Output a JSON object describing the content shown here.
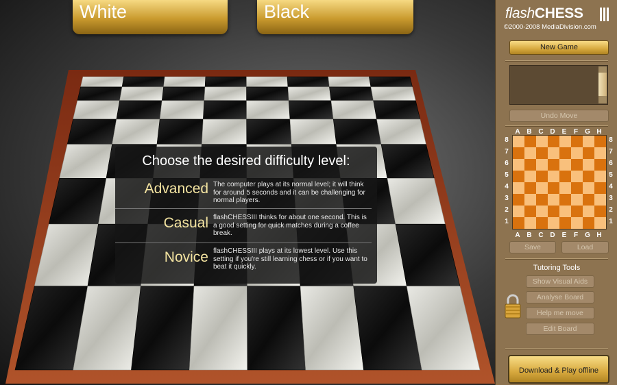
{
  "players": {
    "white_label": "White",
    "black_label": "Black"
  },
  "dialog": {
    "title": "Choose the desired difficulty level:",
    "options": [
      {
        "name": "Advanced",
        "description": "The computer plays at its normal level; it will think for around 5 seconds and it can be challenging for normal players."
      },
      {
        "name": "Casual",
        "description": "flashCHESSIII thinks for about one second. This is a good setting for quick matches during a coffee break."
      },
      {
        "name": "Novice",
        "description": "flashCHESSIII plays at its lowest level. Use this setting if you're still learning chess or if you want to beat it  quickly."
      }
    ]
  },
  "panel": {
    "logo_flash": "flash",
    "logo_chess": "CHESS",
    "copyright": "©2000-2008 MediaDivision.com",
    "new_game": "New Game",
    "undo_move": "Undo Move",
    "files": [
      "A",
      "B",
      "C",
      "D",
      "E",
      "F",
      "G",
      "H"
    ],
    "ranks": [
      "8",
      "7",
      "6",
      "5",
      "4",
      "3",
      "2",
      "1"
    ],
    "save": "Save",
    "load": "Load",
    "tutoring_title": "Tutoring Tools",
    "tools": [
      "Show Visual Aids",
      "Analyse Board",
      "Help me move",
      "Edit Board"
    ],
    "download": "Download & Play offline"
  },
  "colors": {
    "gold": "#d7a93e",
    "mini_light": "#f9c07c",
    "mini_dark": "#d9720e",
    "panel": "#8d7350",
    "option_text": "#f3e3a0"
  },
  "icons": {
    "lock": "padlock-icon"
  }
}
